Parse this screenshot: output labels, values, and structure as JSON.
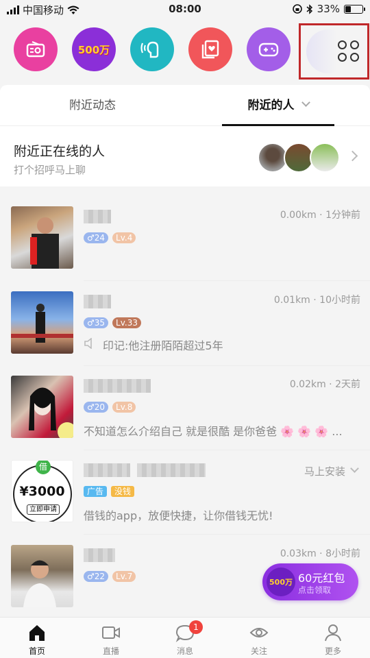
{
  "status_bar": {
    "carrier": "中国移动",
    "time": "08:00",
    "battery": "33%",
    "battery_level": 0.33
  },
  "quick_icons": [
    {
      "name": "radio-icon",
      "color": "#e940a0"
    },
    {
      "name": "lottery-500w-icon",
      "text": "500万",
      "color": "#8b2fd8"
    },
    {
      "name": "voice-chat-icon",
      "color": "#21b7c2"
    },
    {
      "name": "photo-card-icon",
      "color": "#f1565a"
    },
    {
      "name": "game-controller-icon",
      "color": "#a35ee8"
    },
    {
      "name": "more-grid-icon"
    }
  ],
  "tabs": {
    "nearby_feed": "附近动态",
    "nearby_people": "附近的人"
  },
  "online": {
    "title": "附近正在线的人",
    "subtitle": "打个招呼马上聊"
  },
  "people": [
    {
      "gender_age": "♂24",
      "level": "Lv.4",
      "distance": "0.00km · 1分钟前",
      "desc": ""
    },
    {
      "gender_age": "♂35",
      "level": "Lv.33",
      "distance": "0.01km · 10小时前",
      "desc": "印记:他注册陌陌超过5年"
    },
    {
      "gender_age": "♂20",
      "level": "Lv.8",
      "distance": "0.02km · 2天前",
      "desc": "不知道怎么介绍自己 就是很酷 是你爸爸 🌸 🌸 🌸 ..."
    },
    {
      "ad_tag": "广告",
      "ad_tag2": "没钱",
      "action": "马上安装",
      "desc": "借钱的app，放便快捷，让你借钱无忧!",
      "ad_badge": "借",
      "ad_amount": "¥3000",
      "ad_button": "立即申请"
    },
    {
      "gender_age": "♂22",
      "level": "Lv.7",
      "distance": "0.03km · 8小时前",
      "desc": ""
    }
  ],
  "red_packet": {
    "title": "60元红包",
    "subtitle": "点击领取",
    "coin": "500万"
  },
  "nav": {
    "home": "首页",
    "live": "直播",
    "messages": "消息",
    "follow": "关注",
    "more": "更多",
    "badge": "1"
  }
}
